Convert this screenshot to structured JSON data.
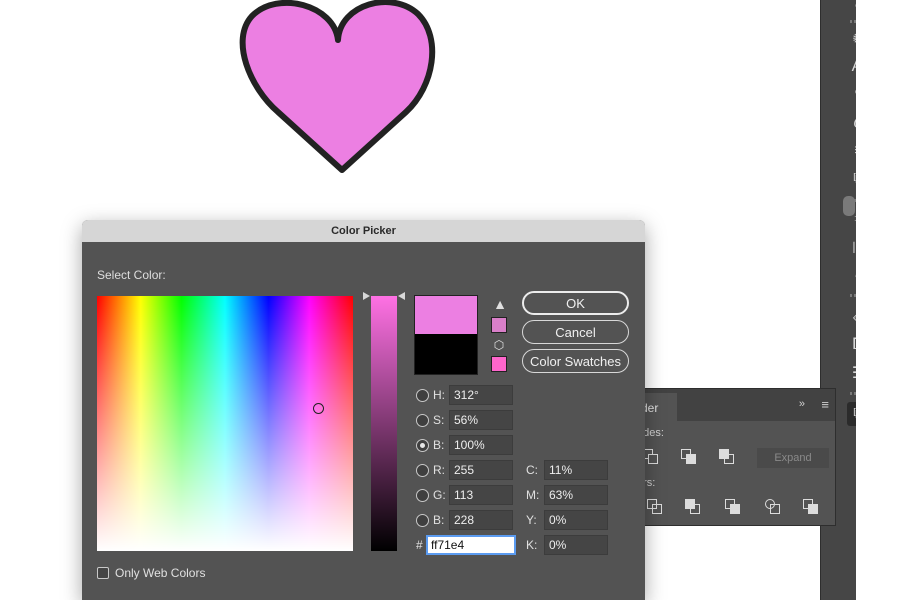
{
  "dialog": {
    "title": "Color Picker",
    "select_label": "Select Color:",
    "buttons": {
      "ok": "OK",
      "cancel": "Cancel",
      "swatches": "Color Swatches"
    },
    "new_color": "#ec7fe2",
    "old_color": "#000000",
    "fields": {
      "H": {
        "label": "H:",
        "value": "312°",
        "checked": false
      },
      "S": {
        "label": "S:",
        "value": "56%",
        "checked": false
      },
      "B": {
        "label": "B:",
        "value": "100%",
        "checked": true
      },
      "R": {
        "label": "R:",
        "value": "255",
        "checked": false
      },
      "G": {
        "label": "G:",
        "value": "113",
        "checked": false
      },
      "Bl": {
        "label": "B:",
        "value": "228",
        "checked": false
      }
    },
    "cmyk": {
      "C": {
        "label": "C:",
        "value": "11%"
      },
      "M": {
        "label": "M:",
        "value": "63%"
      },
      "Y": {
        "label": "Y:",
        "value": "0%"
      },
      "K": {
        "label": "K:",
        "value": "0%"
      }
    },
    "hex": {
      "hash": "#",
      "value": "ff71e4"
    },
    "web_colors_label": "Only Web Colors"
  },
  "pathfinder": {
    "tab_label": "der",
    "collapse": "»",
    "menu": "≡",
    "shape_modes_label": "odes:",
    "pathfinders_label": "ers:",
    "expand_label": "Expand"
  },
  "colors": {
    "heart_fill": "#ec7fe2",
    "heart_stroke": "#222222",
    "hex_focus": "#5b9bf0"
  }
}
